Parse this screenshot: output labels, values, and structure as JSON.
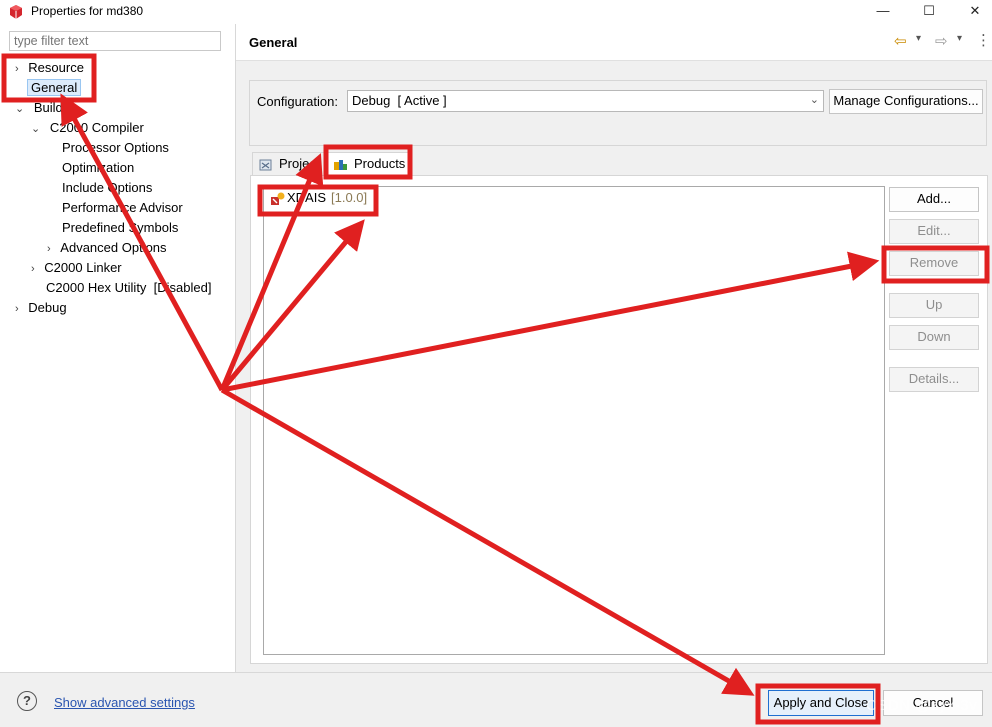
{
  "window": {
    "title": "Properties for md380",
    "minimize": "—",
    "maximize": "☐",
    "close": "✕"
  },
  "sidebar": {
    "filter_placeholder": "type filter text",
    "items": [
      {
        "label": "Resource",
        "chevron": "›"
      },
      {
        "label": "General"
      },
      {
        "label": "Build",
        "chevron": "⌄"
      },
      {
        "label": "C2000 Compiler",
        "chevron": "⌄"
      },
      {
        "label": "Processor Options"
      },
      {
        "label": "Optimization"
      },
      {
        "label": "Include Options"
      },
      {
        "label": "Performance Advisor"
      },
      {
        "label": "Predefined Symbols"
      },
      {
        "label": "Advanced Options",
        "chevron": "›"
      },
      {
        "label": "C2000 Linker",
        "chevron": "›"
      },
      {
        "label": "C2000 Hex Utility  [Disabled]"
      },
      {
        "label": "Debug",
        "chevron": "›"
      }
    ]
  },
  "header": {
    "title": "General",
    "back_icon": "⇦",
    "forward_icon": "⇨",
    "menu_icon": "⋮",
    "dropdown_icon": "▾"
  },
  "configuration": {
    "label": "Configuration:",
    "value": "Debug  [ Active ]",
    "manage_button": "Manage Configurations..."
  },
  "tabs": [
    {
      "label": "Project"
    },
    {
      "label": "Products"
    }
  ],
  "products": {
    "items": [
      {
        "name": "XDAIS",
        "version": "[1.0.0]"
      }
    ],
    "buttons": {
      "add": "Add...",
      "edit": "Edit...",
      "remove": "Remove",
      "up": "Up",
      "down": "Down",
      "details": "Details..."
    }
  },
  "footer": {
    "help_icon": "?",
    "advanced_link": "Show advanced settings",
    "apply_button": "Apply and Close",
    "cancel_button": "Cancel",
    "watermark": "CSDN @zyx-3v"
  },
  "colors": {
    "annotation_red": "#e02020",
    "selection_bg": "#dcebfb",
    "link_blue": "#2a55b0"
  }
}
